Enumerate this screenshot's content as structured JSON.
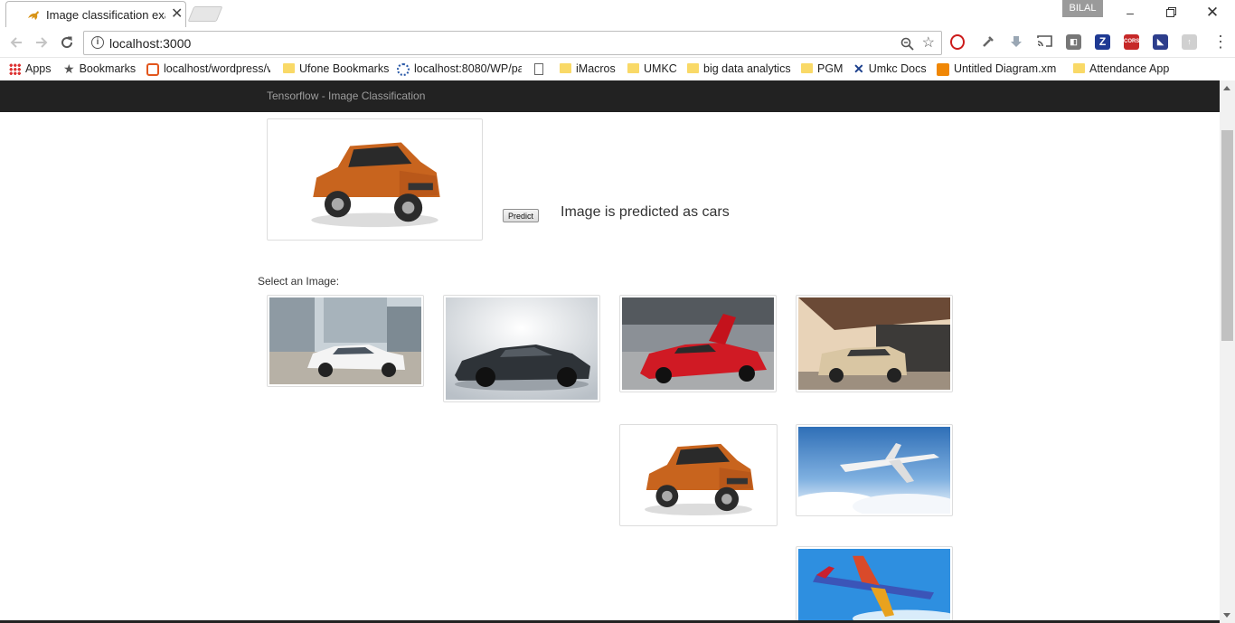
{
  "browser": {
    "tab_title": "Image classification exam",
    "profile_name": "BILAL",
    "url": "localhost:3000",
    "icons": {
      "back": "arrow-left-icon",
      "forward": "arrow-right-icon",
      "reload": "reload-icon",
      "info": "info-icon",
      "zoom": "zoom-icon",
      "star": "star-icon",
      "menu": "more-vertical-icon"
    },
    "bookmarks": [
      {
        "label": "Apps",
        "icon": "apps-grid-icon"
      },
      {
        "label": "Bookmarks",
        "icon": "star-icon"
      },
      {
        "label": "localhost/wordpress/v",
        "icon": "wordpress-site-icon"
      },
      {
        "label": "Ufone Bookmarks",
        "icon": "folder-icon"
      },
      {
        "label": "localhost:8080/WP/pa",
        "icon": "gear-site-icon"
      },
      {
        "label": "",
        "icon": "page-icon"
      },
      {
        "label": "iMacros",
        "icon": "folder-icon"
      },
      {
        "label": "UMKC",
        "icon": "folder-icon"
      },
      {
        "label": "big data analytics",
        "icon": "folder-icon"
      },
      {
        "label": "PGM",
        "icon": "folder-icon"
      },
      {
        "label": "Umkc Docs",
        "icon": "x-site-icon"
      },
      {
        "label": "Untitled Diagram.xml",
        "icon": "drawio-icon"
      },
      {
        "label": "Attendance App",
        "icon": "folder-icon"
      }
    ]
  },
  "page": {
    "navbar_brand": "Tensorflow - Image Classification",
    "predict_button": "Predict",
    "prediction_text": "Image is predicted as cars",
    "select_label": "Select an Image:",
    "selected_image": "orange-suv-image",
    "gallery": [
      {
        "name": "white-sedan-image"
      },
      {
        "name": "black-sports-car-image"
      },
      {
        "name": "red-supercar-image"
      },
      {
        "name": "gold-suv-image"
      },
      {
        "name": "orange-suv-image"
      },
      {
        "name": "airplane-clouds-image"
      },
      {
        "name": "airplane-blue-sky-image"
      }
    ]
  },
  "colors": {
    "navbar": "#222222",
    "navbar_text": "#9d9d9d",
    "thumbnail_border": "#dddddd"
  }
}
